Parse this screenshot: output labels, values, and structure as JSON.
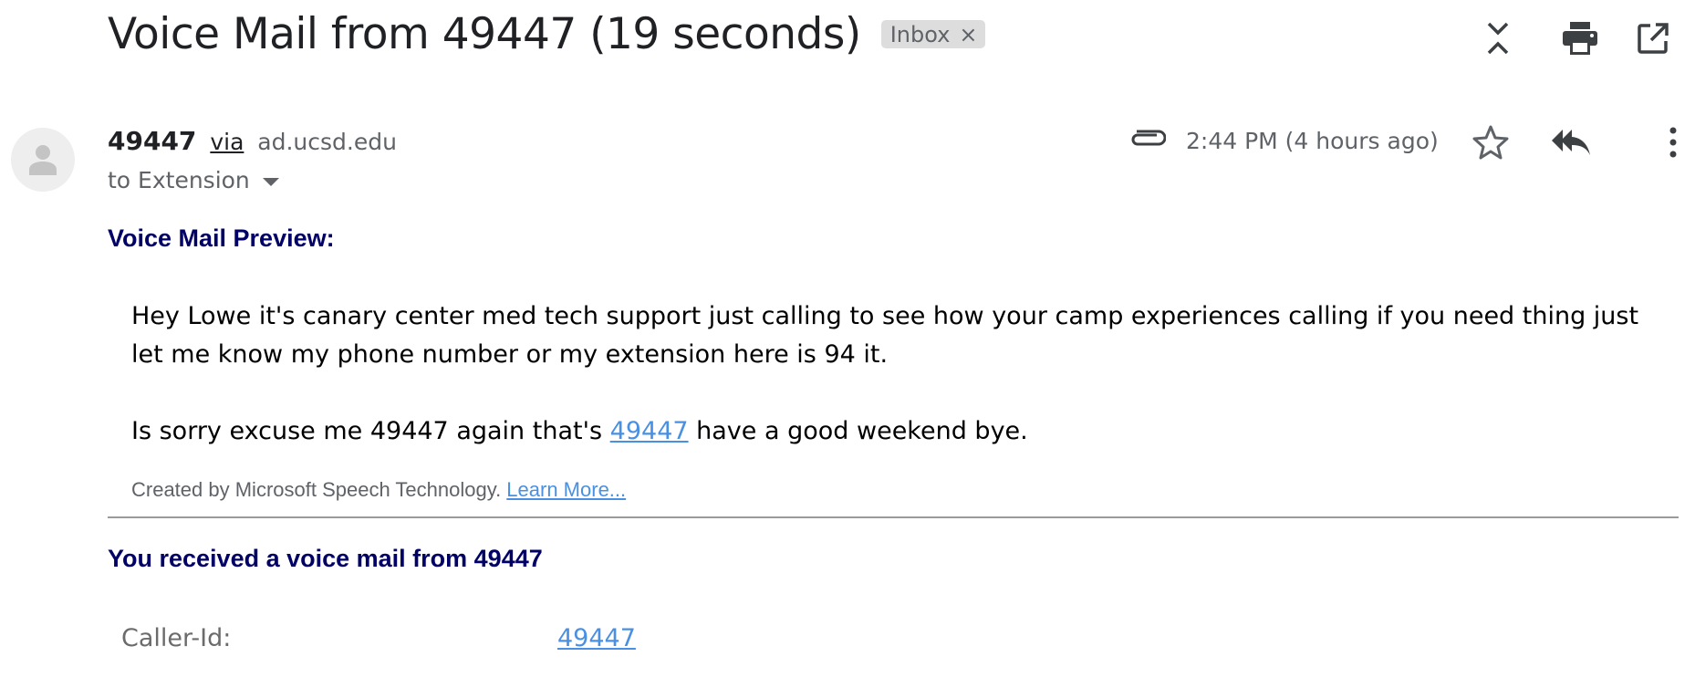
{
  "email": {
    "subject": "Voice Mail from 49447 (19 seconds)",
    "label_chip": "Inbox",
    "label_chip_close": "×",
    "sender_name": "49447",
    "via_text": "via",
    "via_domain": "ad.ucsd.edu",
    "recipient": "to Extension",
    "timestamp": "2:44 PM (4 hours ago)"
  },
  "body": {
    "preview_heading": "Voice Mail Preview:",
    "transcript_line1": "Hey Lowe it's canary center med tech support just calling to see how your camp experiences calling if you need thing just let me know my phone number or my extension here is 94 it.",
    "transcript_line2_before": "Is sorry excuse me 49447 again that's ",
    "transcript_line2_link": "49447",
    "transcript_line2_after": " have a good weekend bye.",
    "created_by": "Created by Microsoft Speech Technology. ",
    "learn_more": "Learn More...",
    "received_heading": "You received a voice mail from 49447",
    "caller_id_label": "Caller-Id:",
    "caller_id_value": "49447"
  },
  "icons": {
    "expand_collapse": "collapse-all-icon",
    "print": "print-icon",
    "open_new_window": "open-in-new-window-icon",
    "attachment": "paperclip-icon",
    "star": "star-icon",
    "reply_all": "reply-all-icon",
    "more": "more-vertical-icon",
    "avatar": "person-icon"
  },
  "colors": {
    "heading_navy": "#000066",
    "link_blue": "#4a90e2",
    "chip_bg": "#dddddd",
    "muted_gray": "#5f6368"
  }
}
